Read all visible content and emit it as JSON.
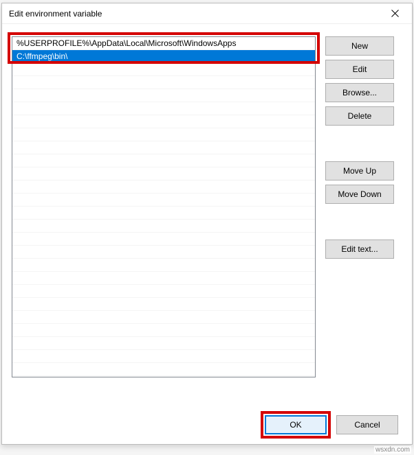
{
  "dialog": {
    "title": "Edit environment variable",
    "close_label": "Close"
  },
  "list": {
    "items": [
      "%USERPROFILE%\\AppData\\Local\\Microsoft\\WindowsApps",
      "C:\\ffmpeg\\bin\\"
    ],
    "selected_index": 1,
    "editing_value": "C:\\ffmpeg\\bin\\"
  },
  "buttons": {
    "new": "New",
    "edit": "Edit",
    "browse": "Browse...",
    "delete": "Delete",
    "move_up": "Move Up",
    "move_down": "Move Down",
    "edit_text": "Edit text...",
    "ok": "OK",
    "cancel": "Cancel"
  },
  "watermark": "wsxdn.com",
  "highlight_color": "#d40000",
  "selection_color": "#0078d7"
}
